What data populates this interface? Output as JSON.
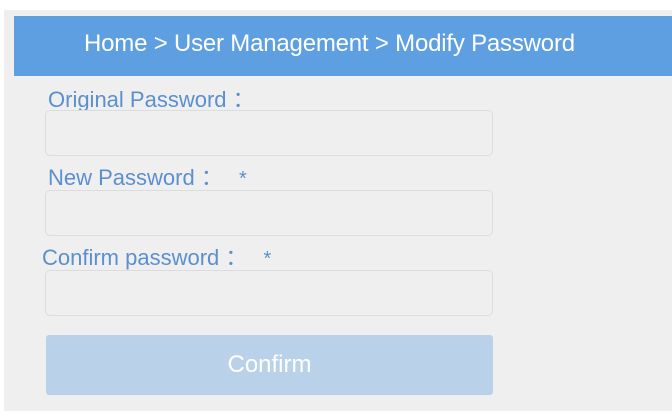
{
  "breadcrumb": {
    "text": "Home > User Management > Modify Password"
  },
  "form": {
    "original_label": "Original Password ：",
    "new_label": "New Password ：",
    "confirm_label": "Confirm password ：",
    "required_marker": "*",
    "original_value": "",
    "new_value": "",
    "confirm_value": "",
    "submit_label": "Confirm"
  },
  "colors": {
    "header_bg": "#5e9fe1",
    "label_text": "#5b8fcf",
    "button_bg": "#b9d2ea",
    "panel_bg": "#efefef"
  }
}
